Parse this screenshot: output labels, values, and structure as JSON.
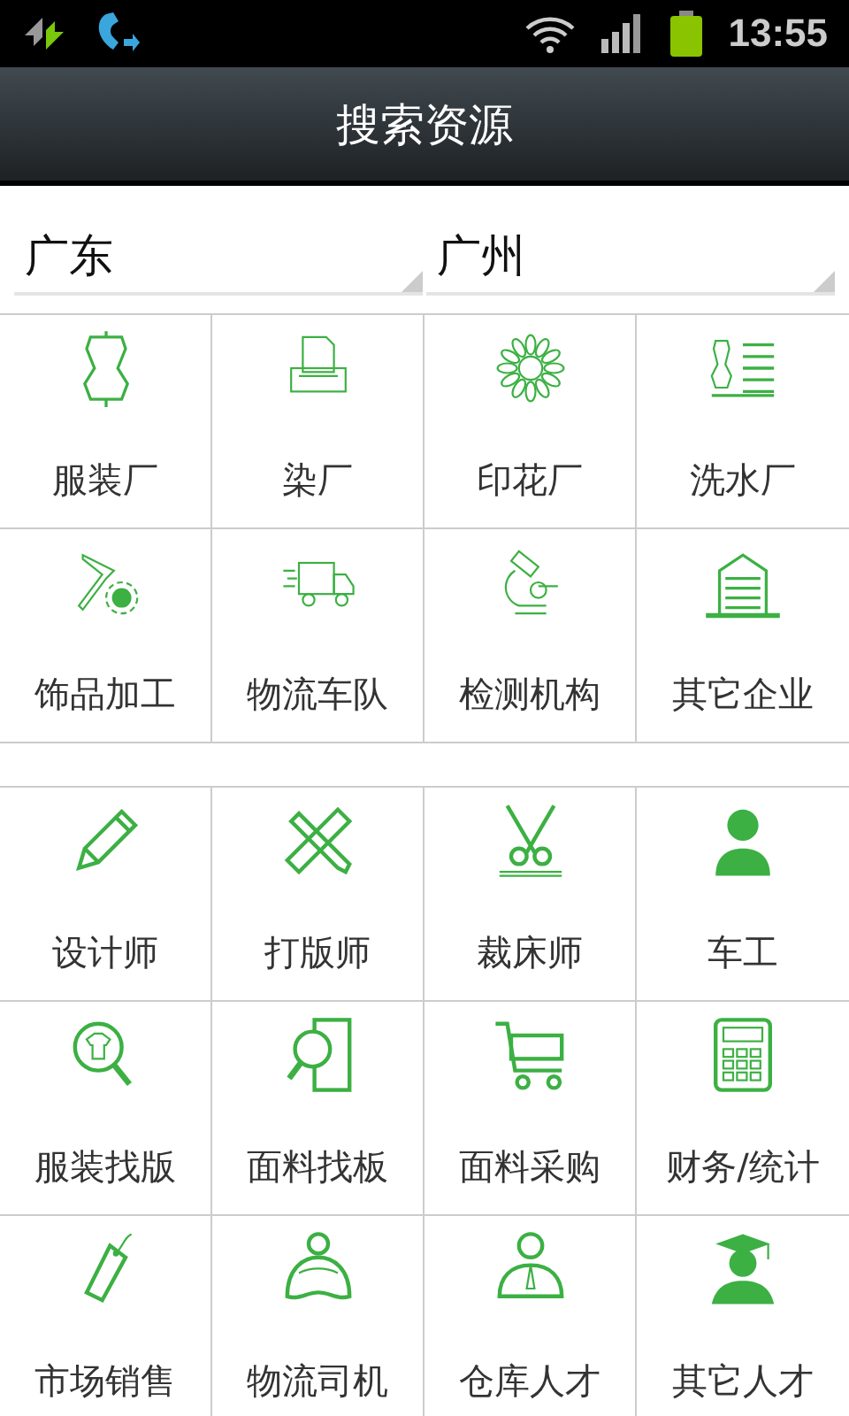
{
  "status_bar": {
    "time": "13:55"
  },
  "title": "搜索资源",
  "selects": [
    {
      "value": "广东"
    },
    {
      "value": "广州"
    }
  ],
  "groups": [
    {
      "items": [
        {
          "label": "服装厂"
        },
        {
          "label": "染厂"
        },
        {
          "label": "印花厂"
        },
        {
          "label": "洗水厂"
        },
        {
          "label": "饰品加工"
        },
        {
          "label": "物流车队"
        },
        {
          "label": "检测机构"
        },
        {
          "label": "其它企业"
        }
      ]
    },
    {
      "items": [
        {
          "label": "设计师"
        },
        {
          "label": "打版师"
        },
        {
          "label": "裁床师"
        },
        {
          "label": "车工"
        },
        {
          "label": "服装找版"
        },
        {
          "label": "面料找板"
        },
        {
          "label": "面料采购"
        },
        {
          "label": "财务/统计"
        },
        {
          "label": "市场销售"
        },
        {
          "label": "物流司机"
        },
        {
          "label": "仓库人才"
        },
        {
          "label": "其它人才"
        }
      ]
    }
  ]
}
